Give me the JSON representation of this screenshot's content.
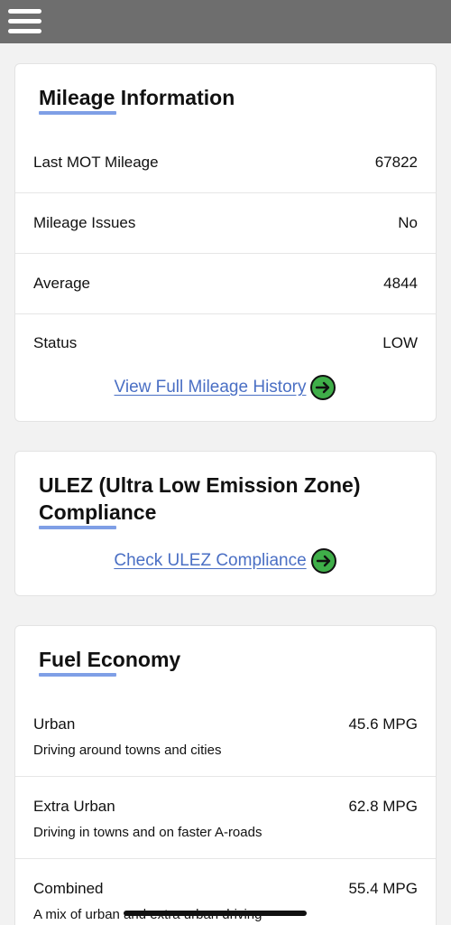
{
  "header": {
    "menu_icon": "hamburger-menu-icon"
  },
  "colors": {
    "topbar": "#6e6e6e",
    "link": "#4a6fc4",
    "arrow_fill": "#3fae49",
    "title_underline": "#7f9fe6"
  },
  "mileage": {
    "title": "Mileage Information",
    "rows": [
      {
        "label": "Last MOT Mileage",
        "value": "67822"
      },
      {
        "label": "Mileage Issues",
        "value": "No"
      },
      {
        "label": "Average",
        "value": "4844"
      },
      {
        "label": "Status",
        "value": "LOW"
      }
    ],
    "link_label": "View Full Mileage History"
  },
  "ulez": {
    "title_line1": "ULEZ (Ultra Low Emission Zone)",
    "title_line2": "Compliance",
    "link_label": "Check ULEZ Compliance"
  },
  "fuel": {
    "title": "Fuel Economy",
    "rows": [
      {
        "label": "Urban",
        "description": "Driving around towns and cities",
        "value": "45.6 MPG"
      },
      {
        "label": "Extra Urban",
        "description": "Driving in towns and on faster A-roads",
        "value": "62.8 MPG"
      },
      {
        "label": "Combined",
        "description": "A mix of urban and extra urban driving",
        "value": "55.4 MPG"
      }
    ]
  }
}
